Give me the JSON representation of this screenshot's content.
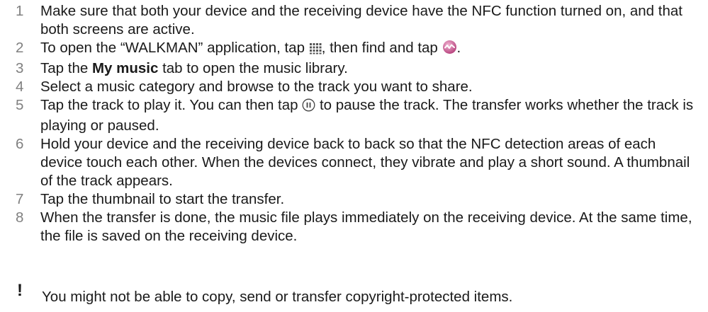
{
  "steps": [
    {
      "num": "1",
      "text": "Make sure that both your device and the receiving device have the NFC function turned on, and that both screens are active."
    },
    {
      "num": "2",
      "a": "To open the “WALKMAN” application, tap ",
      "icon1": "apps-grid-icon",
      "b": ", then find and tap ",
      "icon2": "walkman-app-icon",
      "c": "."
    },
    {
      "num": "3",
      "a": "Tap the ",
      "bold": "My music",
      "b": " tab to open the music library."
    },
    {
      "num": "4",
      "text": "Select a music category and browse to the track you want to share."
    },
    {
      "num": "5",
      "a": "Tap the track to play it. You can then tap ",
      "icon": "pause-icon",
      "b": " to pause the track. The transfer works whether the track is playing or paused."
    },
    {
      "num": "6",
      "text": "Hold your device and the receiving device back to back so that the NFC detection areas of each device touch each other. When the devices connect, they vibrate and play a short sound. A thumbnail of the track appears."
    },
    {
      "num": "7",
      "text": "Tap the thumbnail to start the transfer."
    },
    {
      "num": "8",
      "text": "When the transfer is done, the music file plays immediately on the receiving device. At the same time, the file is saved on the receiving device."
    }
  ],
  "note": {
    "mark": "!",
    "text": "You might not be able to copy, send or transfer copyright-protected items."
  },
  "colors": {
    "step_number": "#808080",
    "text": "#1a1a1a",
    "walkman_icon": "#d06aa0"
  }
}
